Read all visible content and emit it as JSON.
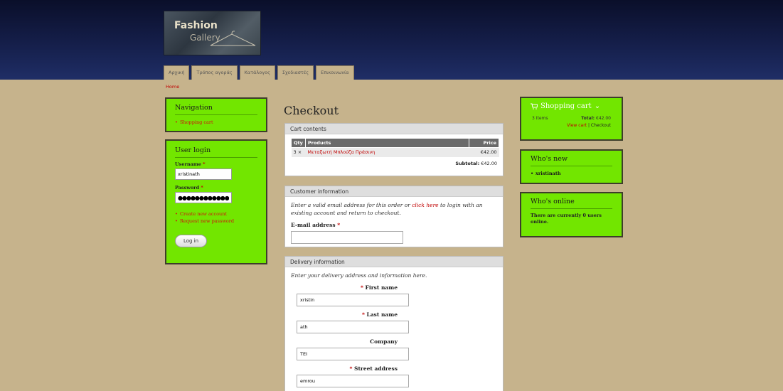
{
  "logo": {
    "line1": "Fashion",
    "line2": "Gallery"
  },
  "tabs": [
    {
      "label": "Αρχική"
    },
    {
      "label": "Τρόπος αγοράς"
    },
    {
      "label": "Κατάλογος"
    },
    {
      "label": "Σχεδιαστές"
    },
    {
      "label": "Επικοινωνία"
    }
  ],
  "breadcrumb": "Home",
  "navigation": {
    "title": "Navigation",
    "items": [
      {
        "label": "Shopping cart"
      }
    ]
  },
  "login": {
    "title": "User login",
    "username_label": "Username",
    "username_value": "xristinath",
    "password_label": "Password",
    "password_value": "●●●●●●●●●●●●",
    "required_mark": "*",
    "links": [
      {
        "label": "Create new account"
      },
      {
        "label": "Request new password"
      }
    ],
    "button": "Log in"
  },
  "main": {
    "title": "Checkout",
    "cart": {
      "heading": "Cart contents",
      "columns": [
        "Qty",
        "Products",
        "Price"
      ],
      "rows": [
        {
          "qty": "3 ×",
          "product": "Μεταξωτή Μπλούζα Πράσινη",
          "price": "€42.00"
        }
      ],
      "subtotal_label": "Subtotal:",
      "subtotal_value": "€42.00"
    },
    "customer": {
      "heading": "Customer information",
      "text_before": "Enter a valid email address for this order or ",
      "link": "click here",
      "text_after": " to login with an existing account and return to checkout.",
      "email_label": "E-mail address",
      "email_value": ""
    },
    "delivery": {
      "heading": "Delivery information",
      "intro": "Enter your delivery address and information here.",
      "fields": [
        {
          "label": "First name",
          "required": "*",
          "value": "xristin"
        },
        {
          "label": "Last name",
          "required": "*",
          "value": "ath"
        },
        {
          "label": "Company",
          "required": "",
          "value": "TEI"
        },
        {
          "label": "Street address",
          "required": "*",
          "value": "emrou"
        }
      ]
    }
  },
  "sidebar_right": {
    "cart": {
      "title": "Shopping cart",
      "chevron": "⌄",
      "items": "3 Items",
      "total_label": "Total:",
      "total_value": "€42.00",
      "view_cart": "View cart",
      "separator": "|",
      "checkout": "Checkout"
    },
    "whos_new": {
      "title": "Who's new",
      "items": [
        {
          "label": "xristinath"
        }
      ]
    },
    "whos_online": {
      "title": "Who's online",
      "text": "There are currently 0 users online."
    }
  },
  "colors": {
    "accent_block": "#72e600",
    "link_red": "#c00000",
    "page_bg": "#c6b38c",
    "header_dark": "#0a0f2a"
  }
}
